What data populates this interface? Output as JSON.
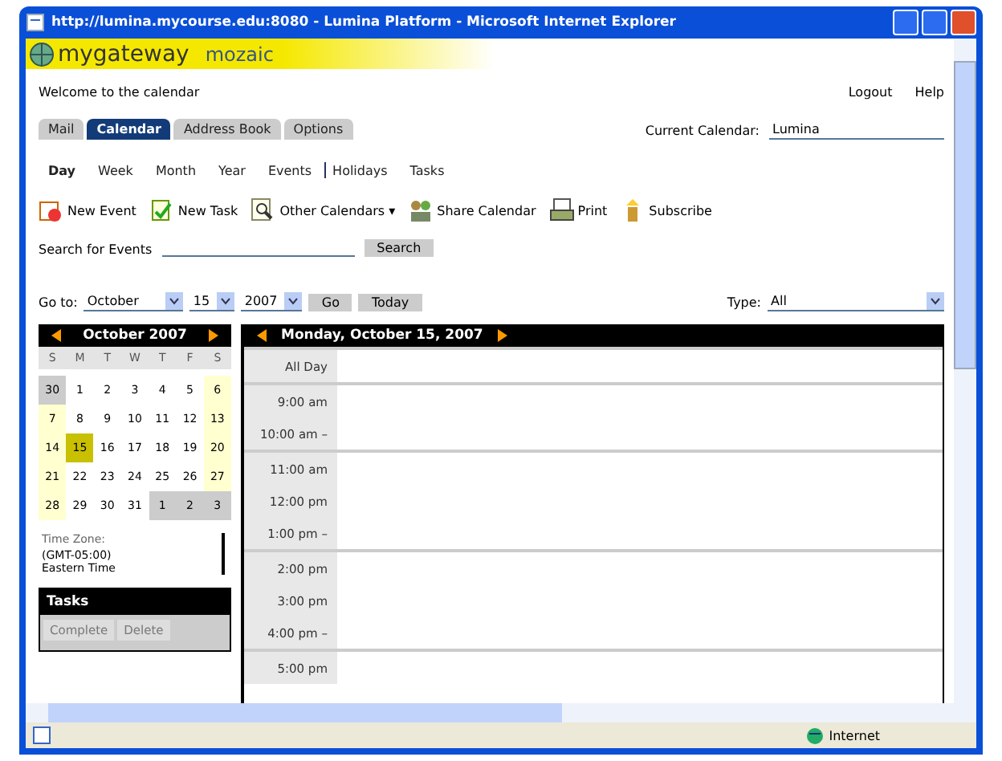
{
  "window": {
    "title": "http://lumina.mycourse.edu:8080 - Lumina Platform - Microsoft Internet Explorer"
  },
  "logo": {
    "name": "mygateway",
    "suffix": "mozaic"
  },
  "welcome": "Welcome to the calendar",
  "top_links": [
    "Logout",
    "Help"
  ],
  "tabs": [
    {
      "label": "Mail",
      "selected": false
    },
    {
      "label": "Calendar",
      "selected": true
    },
    {
      "label": "Address Book",
      "selected": false
    },
    {
      "label": "Options",
      "selected": false
    }
  ],
  "current_calendar": {
    "label": "Current Calendar:",
    "value": "Lumina"
  },
  "views": [
    {
      "label": "Day",
      "selected": true
    },
    {
      "label": "Week",
      "selected": false
    },
    {
      "label": "Month",
      "selected": false
    },
    {
      "label": "Year",
      "selected": false
    },
    {
      "label": "Events",
      "selected": false
    },
    {
      "label": "Holidays",
      "selected": false
    },
    {
      "label": "Tasks",
      "selected": false
    }
  ],
  "toolbar": [
    {
      "label": "New Event",
      "kind": "event"
    },
    {
      "label": "New Task",
      "kind": "task"
    },
    {
      "label": "Other Calendars ▾",
      "kind": "calendars"
    },
    {
      "label": "Share Calendar",
      "kind": "share"
    },
    {
      "label": "Print",
      "kind": "print"
    },
    {
      "label": "Subscribe",
      "kind": "subscribe"
    }
  ],
  "search": {
    "label": "Search for Events",
    "button": "Search"
  },
  "goto": {
    "label": "Go to:",
    "month": "October",
    "day": "15",
    "year": "2007",
    "go": "Go",
    "today": "Today"
  },
  "type": {
    "label": "Type:",
    "value": "All"
  },
  "mini_calendar": {
    "title": "October 2007",
    "weekdays": [
      "S",
      "M",
      "T",
      "W",
      "T",
      "F",
      "S"
    ],
    "weeks": [
      [
        {
          "day": "30",
          "other": true,
          "selected": false
        },
        {
          "day": "1",
          "other": false,
          "selected": false
        },
        {
          "day": "2",
          "other": false,
          "selected": false
        },
        {
          "day": "3",
          "other": false,
          "selected": false
        },
        {
          "day": "4",
          "other": false,
          "selected": false
        },
        {
          "day": "5",
          "other": false,
          "selected": false
        },
        {
          "day": "6",
          "other": false,
          "selected": false
        }
      ],
      [
        {
          "day": "7",
          "other": false,
          "selected": false
        },
        {
          "day": "8",
          "other": false,
          "selected": false
        },
        {
          "day": "9",
          "other": false,
          "selected": false
        },
        {
          "day": "10",
          "other": false,
          "selected": false
        },
        {
          "day": "11",
          "other": false,
          "selected": false
        },
        {
          "day": "12",
          "other": false,
          "selected": false
        },
        {
          "day": "13",
          "other": false,
          "selected": false
        }
      ],
      [
        {
          "day": "14",
          "other": false,
          "selected": false
        },
        {
          "day": "15",
          "other": false,
          "selected": true
        },
        {
          "day": "16",
          "other": false,
          "selected": false
        },
        {
          "day": "17",
          "other": false,
          "selected": false
        },
        {
          "day": "18",
          "other": false,
          "selected": false
        },
        {
          "day": "19",
          "other": false,
          "selected": false
        },
        {
          "day": "20",
          "other": false,
          "selected": false
        }
      ],
      [
        {
          "day": "21",
          "other": false,
          "selected": false
        },
        {
          "day": "22",
          "other": false,
          "selected": false
        },
        {
          "day": "23",
          "other": false,
          "selected": false
        },
        {
          "day": "24",
          "other": false,
          "selected": false
        },
        {
          "day": "25",
          "other": false,
          "selected": false
        },
        {
          "day": "26",
          "other": false,
          "selected": false
        },
        {
          "day": "27",
          "other": false,
          "selected": false
        }
      ],
      [
        {
          "day": "28",
          "other": false,
          "selected": false
        },
        {
          "day": "29",
          "other": false,
          "selected": false
        },
        {
          "day": "30",
          "other": false,
          "selected": false
        },
        {
          "day": "31",
          "other": false,
          "selected": false
        },
        {
          "day": "1",
          "other": true,
          "selected": false
        },
        {
          "day": "2",
          "other": true,
          "selected": false
        },
        {
          "day": "3",
          "other": true,
          "selected": false
        }
      ]
    ]
  },
  "timezone": [
    "Time Zone:",
    "(GMT-05:00)",
    "Eastern Time"
  ],
  "tasks": {
    "title": "Tasks",
    "buttons": [
      "Complete",
      "Delete"
    ]
  },
  "day_view": {
    "title": "Monday, October 15, 2007",
    "slots": [
      {
        "time": "All Day",
        "hour_start": true
      },
      {
        "time": "9:00 am",
        "hour_start": true
      },
      {
        "time": "10:00 am –",
        "hour_start": false
      },
      {
        "time": "11:00 am",
        "hour_start": true
      },
      {
        "time": "12:00 pm",
        "hour_start": false
      },
      {
        "time": "1:00 pm –",
        "hour_start": false
      },
      {
        "time": "2:00 pm",
        "hour_start": true
      },
      {
        "time": "3:00 pm",
        "hour_start": false
      },
      {
        "time": "4:00 pm –",
        "hour_start": false
      },
      {
        "time": "5:00 pm",
        "hour_start": true
      }
    ]
  },
  "status_bar": {
    "zone": "Internet"
  }
}
